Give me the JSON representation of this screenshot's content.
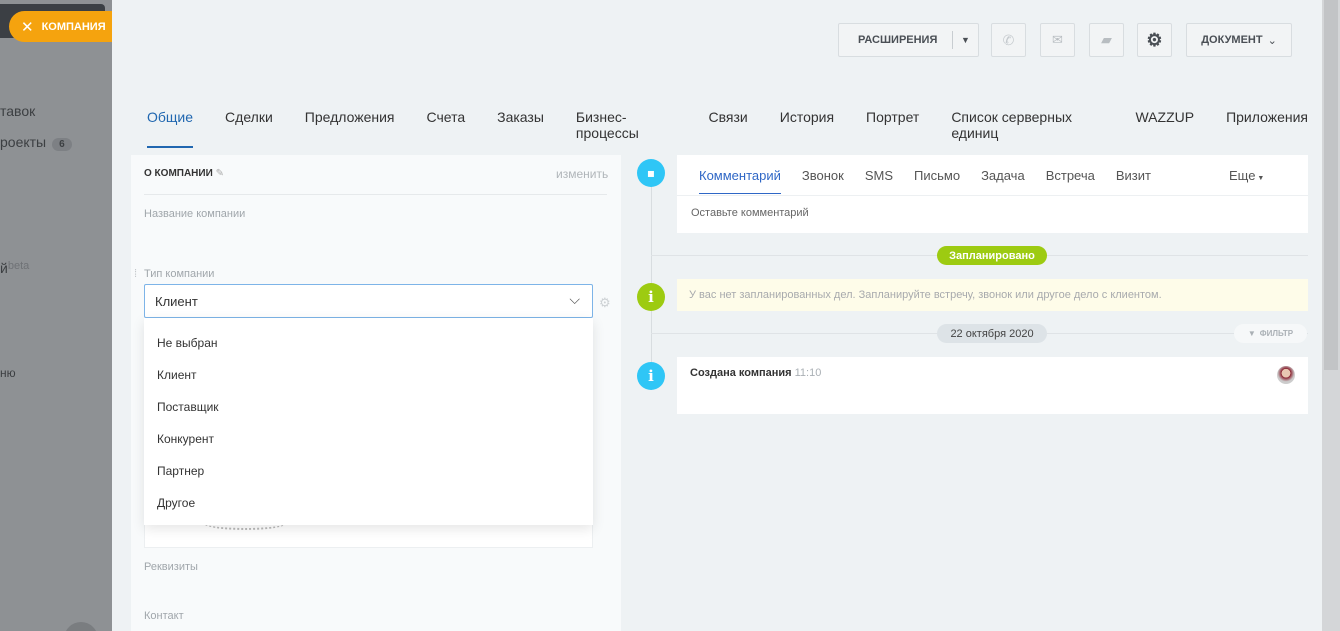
{
  "sidebar": {
    "company_tag": "КОМПАНИЯ",
    "items": [
      "тавок",
      "роекты",
      "й",
      "ню"
    ],
    "projects_badge": "6",
    "beta": "beta"
  },
  "toolbar": {
    "extensions": "РАСШИРЕНИЯ",
    "document": "ДОКУМЕНТ"
  },
  "tabs": [
    "Общие",
    "Сделки",
    "Предложения",
    "Счета",
    "Заказы",
    "Бизнес-процессы",
    "Связи",
    "История",
    "Портрет",
    "Список серверных единиц",
    "WAZZUP",
    "Приложения"
  ],
  "about": {
    "title": "О КОМПАНИИ",
    "edit": "изменить",
    "name_label": "Название компании",
    "type_label": "Тип компании",
    "type_value": "Клиент",
    "options": [
      "Не выбран",
      "Клиент",
      "Поставщик",
      "Конкурент",
      "Партнер",
      "Другое"
    ],
    "requisites_label": "Реквизиты",
    "contact_label": "Контакт"
  },
  "timeline": {
    "tabs": [
      "Комментарий",
      "Звонок",
      "SMS",
      "Письмо",
      "Задача",
      "Встреча",
      "Визит"
    ],
    "more": "Еще",
    "comment_placeholder": "Оставьте комментарий",
    "planned_badge": "Запланировано",
    "no_plans": "У вас нет запланированных дел. Запланируйте встречу, звонок или другое дело с клиентом.",
    "date_badge": "22 октября 2020",
    "filter": "ФИЛЬТР",
    "event_title": "Создана компания",
    "event_time": "11:10"
  },
  "colors": {
    "accent": "#2067b0",
    "orange": "#f5a30e",
    "green": "#9dcb11",
    "cyan": "#2fc6f6"
  }
}
